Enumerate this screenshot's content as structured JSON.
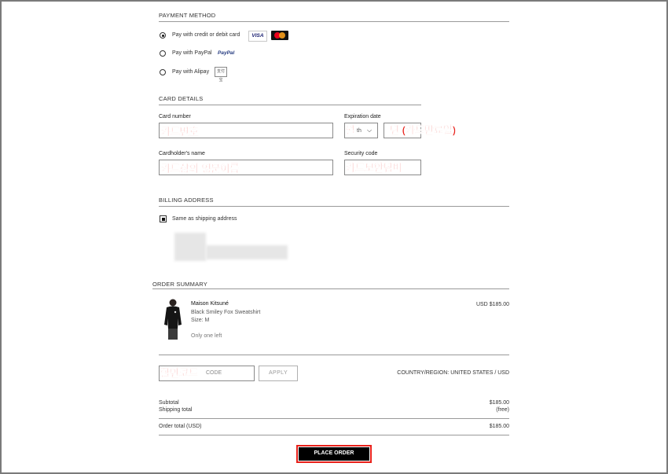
{
  "payment": {
    "title": "PAYMENT METHOD",
    "options": [
      {
        "label": "Pay with credit or debit card",
        "selected": true
      },
      {
        "label": "Pay with PayPal",
        "selected": false
      },
      {
        "label": "Pay with Alipay",
        "selected": false
      }
    ],
    "visa_text": "VISA",
    "paypal_text": "PayPal",
    "alipay_text": "支付宝"
  },
  "card": {
    "title": "CARD DETAILS",
    "number_label": "Card number",
    "number_annotation": "카드번호",
    "expiration_label": "Expiration date",
    "month_annotation": "월",
    "month_partial": "th",
    "year_annotation": "년 (카드만료일)",
    "holder_label": "Cardholder's name",
    "holder_annotation": "카드상의 영문이름",
    "security_label": "Security code",
    "security_annotation": "카드보안넘버"
  },
  "billing": {
    "title": "BILLING ADDRESS",
    "same_as_shipping": "Same as shipping address",
    "same_checked": true
  },
  "summary": {
    "title": "ORDER SUMMARY",
    "item": {
      "brand": "Maison Kitsuné",
      "name": "Black Smiley Fox Sweatshirt",
      "size": "Size: M",
      "stock": "Only one left",
      "price": "$185.00 USD"
    },
    "promo_annotation": "할인코드",
    "promo_placeholder": "CODE",
    "apply_label": "APPLY",
    "country_region": "COUNTRY/REGION: UNITED STATES / USD",
    "subtotal_label": "Subtotal",
    "subtotal_value": "$185.00",
    "shipping_label": "Shipping total",
    "shipping_value": "(free)",
    "order_total_label": "Order total (USD)",
    "order_total_value": "$185.00",
    "place_order_label": "PLACE ORDER"
  },
  "colors": {
    "annotation_red": "#e8201a",
    "button_black": "#000000"
  }
}
